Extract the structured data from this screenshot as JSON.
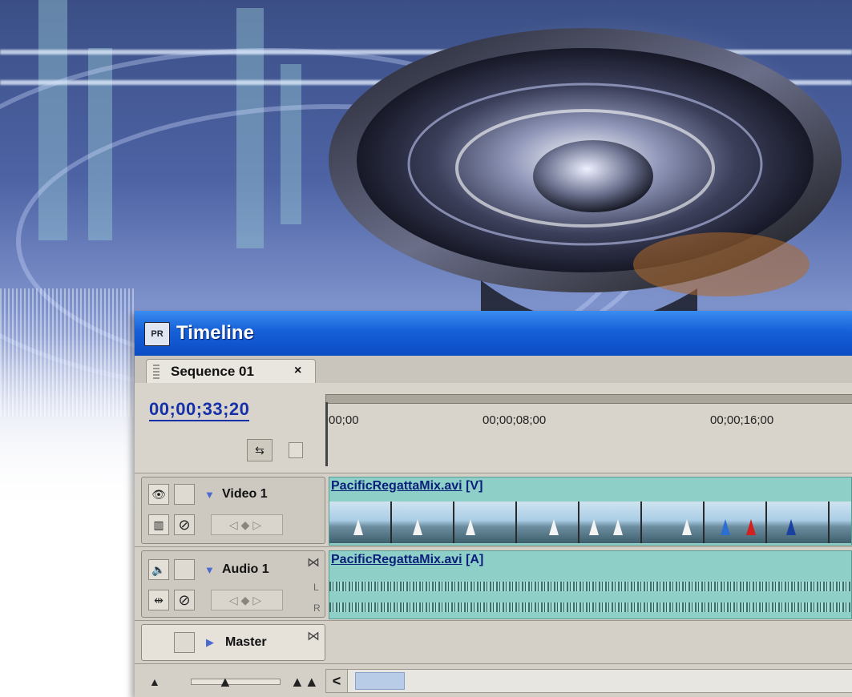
{
  "window": {
    "title": "Timeline",
    "app_icon_text": "PR"
  },
  "sequence_tab": {
    "label": "Sequence 01",
    "close_glyph": "×"
  },
  "timecode": "00;00;33;20",
  "ruler": {
    "ticks": [
      "00;00",
      "00;00;08;00",
      "00;00;16;00"
    ]
  },
  "tracks": {
    "video1": {
      "name": "Video 1",
      "clip_name": "PacificRegattaMix.avi",
      "clip_suffix": "[V]"
    },
    "audio1": {
      "name": "Audio 1",
      "clip_name": "PacificRegattaMix.avi",
      "clip_suffix": "[A]",
      "channel_left": "L",
      "channel_right": "R"
    },
    "master": {
      "name": "Master"
    }
  },
  "icons": {
    "eye": "👁",
    "speaker": "🔈",
    "forbidden": "⊘",
    "nav": "◁◆▷",
    "sync": "⋈",
    "snap": "⇆",
    "triangle_down": "▼",
    "triangle_right": "▶",
    "zoom_out": "▲",
    "zoom_in": "▲▲",
    "scroll_left": "<"
  },
  "colors": {
    "titlebar": "#0b4cc4",
    "timecode": "#1530a8",
    "clip": "#8ecfc7"
  }
}
